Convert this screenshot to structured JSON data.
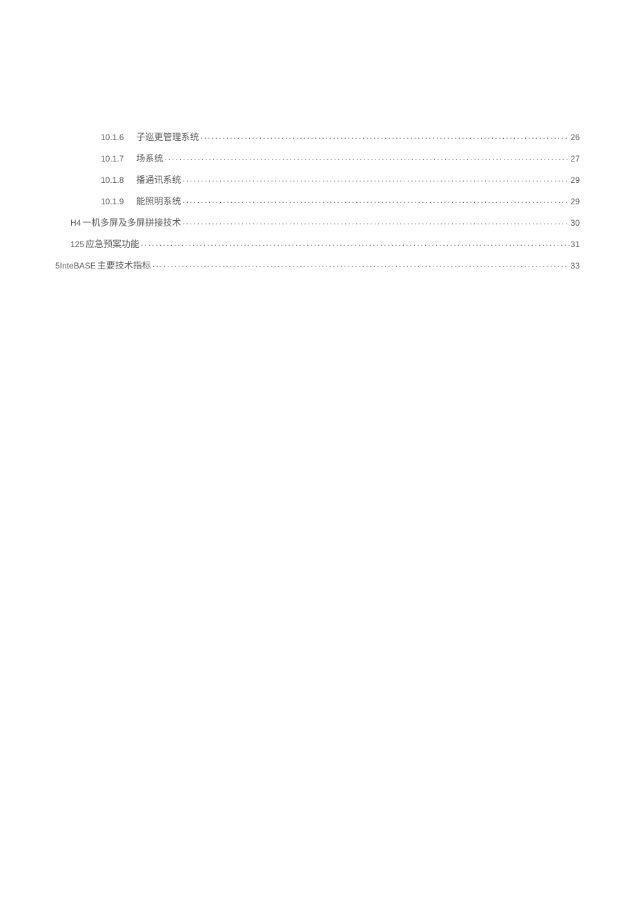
{
  "toc": [
    {
      "indent": 2,
      "num": "10.1.6",
      "title": "子巡更管理系统",
      "page": "26"
    },
    {
      "indent": 2,
      "num": "10.1.7",
      "title": "场系统",
      "page": "27"
    },
    {
      "indent": 2,
      "num": "10.1.8",
      "title": "播通讯系统",
      "page": "29"
    },
    {
      "indent": 2,
      "num": "10.1.9",
      "title": "能照明系统",
      "page": "29"
    },
    {
      "indent": 1,
      "num": "H4",
      "title": "一机多屏及多屏拼接技术",
      "page": "30"
    },
    {
      "indent": 1,
      "num": "125",
      "title": "应急预案功能",
      "page": "31"
    },
    {
      "indent": 0,
      "num": "5InteBASE",
      "title": "主要技术指标",
      "page": "33"
    }
  ]
}
